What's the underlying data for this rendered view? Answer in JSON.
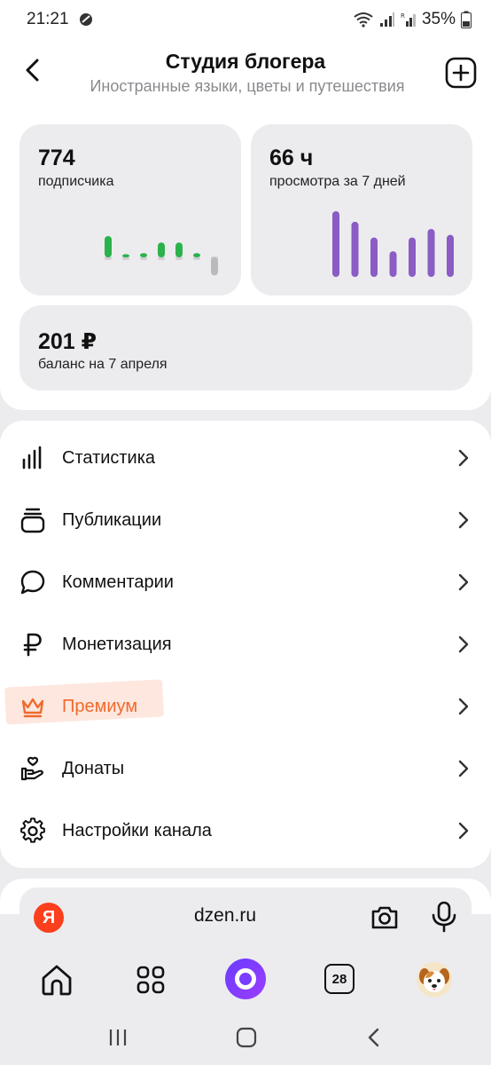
{
  "status": {
    "time": "21:21",
    "battery": "35%",
    "icons": [
      "moon-icon",
      "wifi-icon",
      "signal-icon",
      "signal-icon-2",
      "battery-icon"
    ]
  },
  "header": {
    "title": "Студия блогера",
    "subtitle": "Иностранные языки, цветы и путешествия"
  },
  "stats": {
    "subscribers": {
      "value": "774",
      "label": "подписчика",
      "bars": [
        1.0,
        0.15,
        0.2,
        0.7,
        0.7,
        0.2,
        -0.85
      ]
    },
    "views": {
      "value": "66 ч",
      "label": "просмотра за 7 дней",
      "bars": [
        1.0,
        0.84,
        0.6,
        0.39,
        0.6,
        0.73,
        0.64
      ]
    },
    "balance": {
      "value": "201 ₽",
      "label": "баланс на 7 апреля"
    }
  },
  "menu": [
    {
      "label": "Статистика",
      "icon": "bar-chart-icon"
    },
    {
      "label": "Публикации",
      "icon": "stack-icon"
    },
    {
      "label": "Комментарии",
      "icon": "comment-icon"
    },
    {
      "label": "Монетизация",
      "icon": "ruble-icon"
    },
    {
      "label": "Премиум",
      "icon": "crown-icon"
    },
    {
      "label": "Донаты",
      "icon": "heart-hand-icon"
    },
    {
      "label": "Настройки канала",
      "icon": "gear-icon"
    }
  ],
  "browser": {
    "logo": "Я",
    "url": "dzen.ru"
  },
  "bottom_nav": {
    "calendar_day": "28"
  },
  "colors": {
    "accent_green": "#2bb24c",
    "accent_purple": "#8a5cc4",
    "premium_orange": "#f06a2d"
  }
}
